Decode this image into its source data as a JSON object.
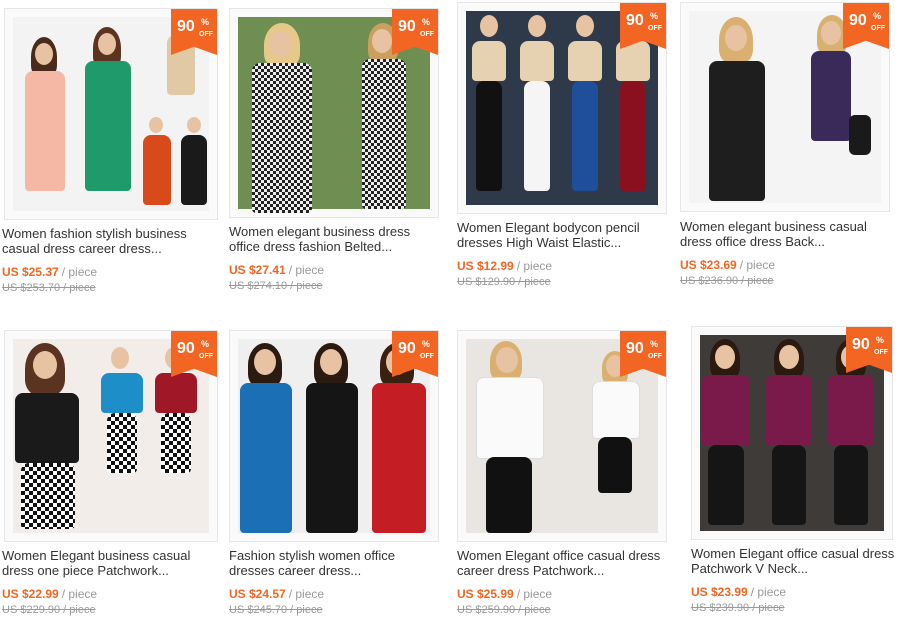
{
  "products": [
    {
      "title": "Women fashion stylish business casual dress career dress...",
      "price": "US $25.37",
      "per": "/ piece",
      "old": "US $253.70 / piece",
      "discount": "90",
      "pct": "%",
      "off": "OFF",
      "bg": "#f3f3f3",
      "dress": "#f5b8a4"
    },
    {
      "title": "Women elegant business dress office dress fashion Belted...",
      "price": "US $27.41",
      "per": "/ piece",
      "old": "US $274.10 / piece",
      "discount": "90",
      "pct": "%",
      "off": "OFF",
      "bg": "#6f8f52",
      "dress": "#222222"
    },
    {
      "title": "Women Elegant bodycon pencil dresses High Waist Elastic...",
      "price": "US $12.99",
      "per": "/ piece",
      "old": "US $129.90 / piece",
      "discount": "90",
      "pct": "%",
      "off": "OFF",
      "bg": "#2e3a4a",
      "dress": "#1f4e9a"
    },
    {
      "title": "Women elegant business casual dress office dress Back...",
      "price": "US $23.69",
      "per": "/ piece",
      "old": "US $236.90 / piece",
      "discount": "90",
      "pct": "%",
      "off": "OFF",
      "bg": "#f4f4f4",
      "dress": "#1e1e1e"
    },
    {
      "title": "Women Elegant business casual dress one piece Patchwork...",
      "price": "US $22.99",
      "per": "/ piece",
      "old": "US $229.90 / piece",
      "discount": "90",
      "pct": "%",
      "off": "OFF",
      "bg": "#f2ede8",
      "dress": "#1a1a1a"
    },
    {
      "title": "Fashion stylish women office dresses career dress...",
      "price": "US $24.57",
      "per": "/ piece",
      "old": "US $245.70 / piece",
      "discount": "90",
      "pct": "%",
      "off": "OFF",
      "bg": "#efefef",
      "dress": "#1b6fb5"
    },
    {
      "title": "Women Elegant office casual dress career dress Patchwork...",
      "price": "US $25.99",
      "per": "/ piece",
      "old": "US $259.90 / piece",
      "discount": "90",
      "pct": "%",
      "off": "OFF",
      "bg": "#e9e6e2",
      "dress": "#111111"
    },
    {
      "title": "Women Elegant office casual dress Patchwork V Neck...",
      "price": "US $23.99",
      "per": "/ piece",
      "old": "US $239.90 / piece",
      "discount": "90",
      "pct": "%",
      "off": "OFF",
      "bg": "#3e3b38",
      "dress": "#7a1a4a"
    }
  ]
}
